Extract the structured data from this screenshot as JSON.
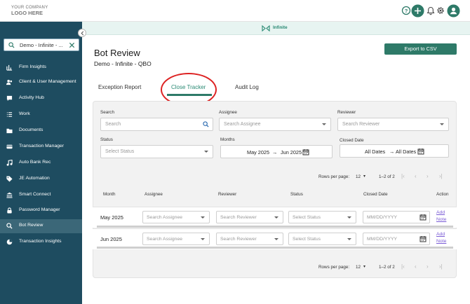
{
  "logo": {
    "line1": "YOUR COMPANY",
    "line2": "LOGO HERE"
  },
  "topbar": {
    "icons": [
      "help-icon",
      "add-icon",
      "bell-icon",
      "gear-icon",
      "user-avatar-icon"
    ]
  },
  "sidebar": {
    "search_value": "Demo - Infinite - ...",
    "items": [
      {
        "label": "Firm Insights",
        "icon": "insights-icon"
      },
      {
        "label": "Client & User Management",
        "icon": "users-icon"
      },
      {
        "label": "Activity Hub",
        "icon": "chat-icon"
      },
      {
        "label": "Work",
        "icon": "list-icon"
      },
      {
        "label": "Documents",
        "icon": "folder-icon"
      },
      {
        "label": "Transaction Manager",
        "icon": "card-icon"
      },
      {
        "label": "Auto Bank Rec",
        "icon": "music-icon"
      },
      {
        "label": "JE Automation",
        "icon": "tag-icon"
      },
      {
        "label": "Smart Connect",
        "icon": "bank-icon"
      },
      {
        "label": "Password Manager",
        "icon": "lock-icon"
      },
      {
        "label": "Bot Review",
        "icon": "search-icon",
        "active": true
      },
      {
        "label": "Transaction Insights",
        "icon": "pie-icon"
      }
    ]
  },
  "banner": {
    "label": "Infinite"
  },
  "page": {
    "title": "Bot Review",
    "subtitle": "Demo - Infinite - QBO",
    "export_label": "Export to CSV"
  },
  "tabs": [
    {
      "label": "Exception Report"
    },
    {
      "label": "Close Tracker",
      "active": true
    },
    {
      "label": "Audit Log"
    }
  ],
  "filters": {
    "search_label": "Search",
    "search_placeholder": "Search",
    "assignee_label": "Assignee",
    "assignee_placeholder": "Search Assignee",
    "reviewer_label": "Reviewer",
    "reviewer_placeholder": "Search Reviewer",
    "status_label": "Status",
    "status_placeholder": "Select Status",
    "months_label": "Months",
    "months_from": "May 2025",
    "months_arrow": "→",
    "months_to": "Jun 2025",
    "closed_label": "Closed Date",
    "closed_from": "All Dates",
    "closed_arrow": "→",
    "closed_to": "All Dates"
  },
  "pager": {
    "rows_label": "Rows per page:",
    "rows_value": "12",
    "range": "1–2 of 2"
  },
  "table": {
    "headers": [
      "Month",
      "Assignee",
      "Reviewer",
      "Status",
      "Closed Date",
      "Action"
    ],
    "rows": [
      {
        "month": "May 2025",
        "assignee": "Search Assignee",
        "reviewer": "Search Reviewer",
        "status": "Select Status",
        "closed": "MM/DD/YYYY",
        "action1": "Add",
        "action2": "Note"
      },
      {
        "month": "Jun 2025",
        "assignee": "Search Assignee",
        "reviewer": "Search Reviewer",
        "status": "Select Status",
        "closed": "MM/DD/YYYY",
        "action1": "Add",
        "action2": "Note"
      }
    ]
  },
  "colors": {
    "sidebar": "#1e4c60",
    "accent": "#2e7a68",
    "highlight_oval": "#dd2222",
    "link": "#7a5bd6"
  }
}
